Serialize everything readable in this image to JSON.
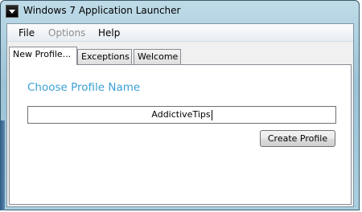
{
  "window": {
    "title": "Windows 7 Application Launcher",
    "icon": "app-launcher-icon"
  },
  "menu": {
    "items": [
      {
        "label": "File",
        "enabled": true
      },
      {
        "label": "Options",
        "enabled": false
      },
      {
        "label": "Help",
        "enabled": true
      }
    ]
  },
  "tabs": [
    {
      "label": "New Profile...",
      "active": true
    },
    {
      "label": "Exceptions",
      "active": false
    },
    {
      "label": "Welcome",
      "active": false
    }
  ],
  "main": {
    "heading": "Choose Profile Name",
    "profile_name_value": "AddictiveTips",
    "create_button_label": "Create Profile"
  },
  "colors": {
    "heading": "#3aa0d6",
    "titlebar": "#a9cfe0"
  }
}
